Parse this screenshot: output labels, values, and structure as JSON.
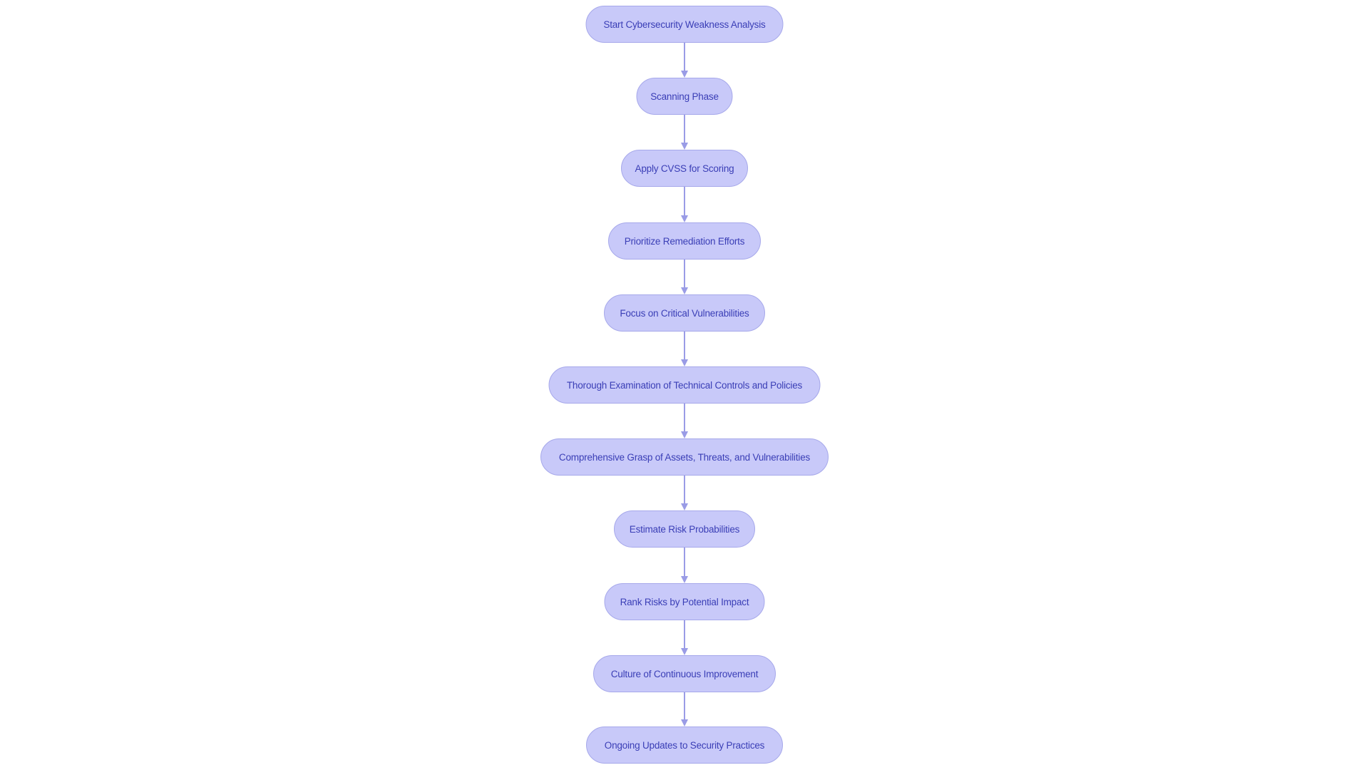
{
  "diagram": {
    "type": "flowchart",
    "direction": "top-to-bottom",
    "colors": {
      "node_fill": "#c8c9f9",
      "node_border": "#a6a8ea",
      "node_text": "#3a3eb6",
      "edge": "#9a9ce6",
      "background": "#ffffff"
    },
    "nodes": [
      {
        "id": "A",
        "label": "Start Cybersecurity Weakness Analysis",
        "shape": "stadium"
      },
      {
        "id": "B",
        "label": "Scanning Phase",
        "shape": "stadium"
      },
      {
        "id": "C",
        "label": "Apply CVSS for Scoring",
        "shape": "stadium"
      },
      {
        "id": "D",
        "label": "Prioritize Remediation Efforts",
        "shape": "stadium"
      },
      {
        "id": "E",
        "label": "Focus on Critical Vulnerabilities",
        "shape": "stadium"
      },
      {
        "id": "F",
        "label": "Thorough Examination of Technical Controls and Policies",
        "shape": "stadium"
      },
      {
        "id": "G",
        "label": "Comprehensive Grasp of Assets, Threats, and Vulnerabilities",
        "shape": "stadium"
      },
      {
        "id": "H",
        "label": "Estimate Risk Probabilities",
        "shape": "stadium"
      },
      {
        "id": "I",
        "label": "Rank Risks by Potential Impact",
        "shape": "stadium"
      },
      {
        "id": "J",
        "label": "Culture of Continuous Improvement",
        "shape": "stadium"
      },
      {
        "id": "K",
        "label": "Ongoing Updates to Security Practices",
        "shape": "stadium"
      }
    ],
    "edges": [
      {
        "from": "A",
        "to": "B"
      },
      {
        "from": "B",
        "to": "C"
      },
      {
        "from": "C",
        "to": "D"
      },
      {
        "from": "D",
        "to": "E"
      },
      {
        "from": "E",
        "to": "F"
      },
      {
        "from": "F",
        "to": "G"
      },
      {
        "from": "G",
        "to": "H"
      },
      {
        "from": "H",
        "to": "I"
      },
      {
        "from": "I",
        "to": "J"
      },
      {
        "from": "J",
        "to": "K"
      }
    ]
  }
}
